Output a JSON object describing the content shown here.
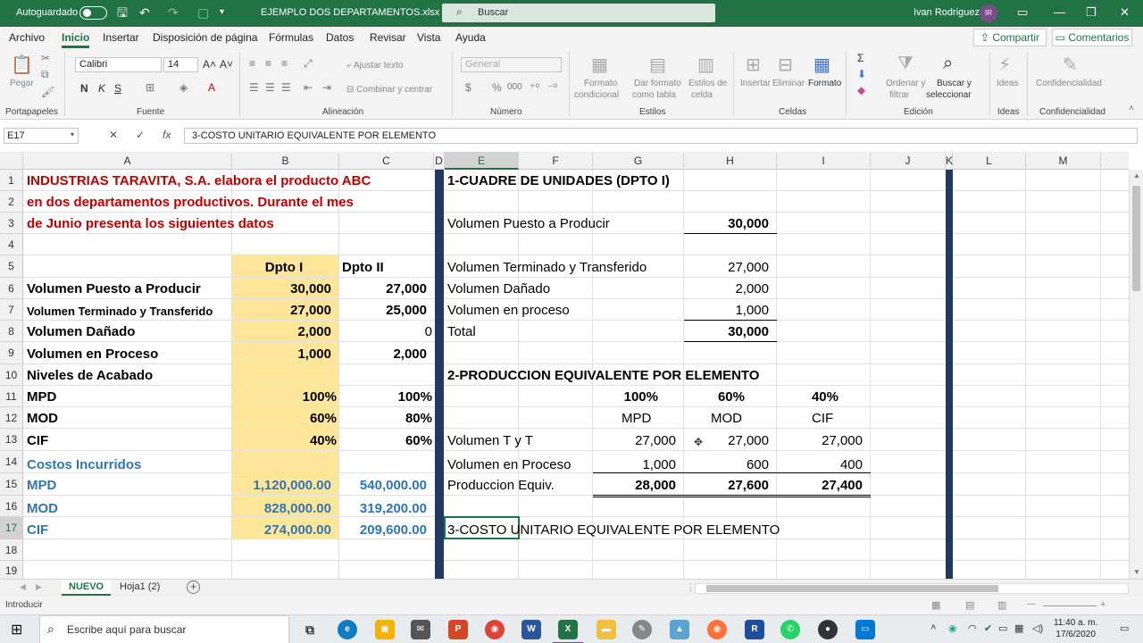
{
  "titlebar": {
    "autosave_label": "Autoguardado",
    "filename": "EJEMPLO DOS DEPARTAMENTOS.xlsx",
    "search_placeholder": "Buscar",
    "user_name": "Ivan Rodriguez",
    "user_initials": "IR"
  },
  "menu": {
    "tabs": [
      "Archivo",
      "Inicio",
      "Insertar",
      "Disposición de página",
      "Fórmulas",
      "Datos",
      "Revisar",
      "Vista",
      "Ayuda"
    ],
    "active_tab": "Inicio",
    "share_label": "Compartir",
    "comments_label": "Comentarios"
  },
  "ribbon": {
    "groups": [
      "Portapapeles",
      "Fuente",
      "Alineación",
      "Número",
      "Estilos",
      "Celdas",
      "Edición",
      "Ideas",
      "Confidencialidad"
    ],
    "paste_label": "Pegar",
    "font_name": "Calibri",
    "font_size": "14",
    "bold": "N",
    "italic": "K",
    "underline": "S",
    "wrap_text": "Ajustar texto",
    "merge_center": "Combinar y centrar",
    "number_format": "General",
    "currency": "$",
    "percent": "%",
    "thousands": "000",
    "cond_format": [
      "Formato",
      "condicional"
    ],
    "table_format": [
      "Dar formato",
      "como tabla"
    ],
    "cell_styles": [
      "Estilos de",
      "celda"
    ],
    "insert": "Insertar",
    "delete": "Eliminar",
    "format": "Formato",
    "sort_filter": [
      "Ordenar y",
      "filtrar"
    ],
    "find_select": [
      "Buscar y",
      "seleccionar"
    ],
    "ideas": "Ideas",
    "confidentiality": "Confidencialidad"
  },
  "formula_bar": {
    "name_box": "E17",
    "cancel": "✕",
    "enter": "✓",
    "fx": "fx",
    "content": "3-COSTO UNITARIO EQUIVALENTE POR ELEMENTO"
  },
  "columns": [
    "A",
    "B",
    "C",
    "D",
    "E",
    "F",
    "G",
    "H",
    "I",
    "J",
    "K",
    "L",
    "M"
  ],
  "rows": [
    "1",
    "2",
    "3",
    "4",
    "5",
    "6",
    "7",
    "8",
    "9",
    "10",
    "11",
    "12",
    "13",
    "14",
    "15",
    "16",
    "17",
    "18",
    "19"
  ],
  "cells": {
    "A1": "INDUSTRIAS TARAVITA, S.A. elabora el producto ABC",
    "A2": "en dos departamentos productivos. Durante el mes",
    "A3": "de Junio presenta los siguientes datos",
    "B5": "Dpto I",
    "C5": "Dpto II",
    "A6": "Volumen Puesto a Producir",
    "B6": "30,000",
    "C6": "27,000",
    "A7": "Volumen Terminado y Transferido",
    "B7": "27,000",
    "C7": "25,000",
    "A8": "Volumen Dañado",
    "B8": "2,000",
    "C8": "0",
    "A9": "Volumen en Proceso",
    "B9": "1,000",
    "C9": "2,000",
    "A10": "Niveles de Acabado",
    "A11": "MPD",
    "B11": "100%",
    "C11": "100%",
    "A12": "MOD",
    "B12": "60%",
    "C12": "80%",
    "A13": "CIF",
    "B13": "40%",
    "C13": "60%",
    "A14": "Costos Incurridos",
    "A15": "MPD",
    "B15": "1,120,000.00",
    "C15": "540,000.00",
    "A16": "MOD",
    "B16": "828,000.00",
    "C16": "319,200.00",
    "A17": "CIF",
    "B17": "274,000.00",
    "C17": "209,600.00",
    "E1": "1-CUADRE DE UNIDADES (DPTO I)",
    "E3": "Volumen Puesto a Producir",
    "H3": "30,000",
    "E5": "Volumen Terminado y Transferido",
    "H5": "27,000",
    "E6": "Volumen Dañado",
    "H6": "2,000",
    "E7": "Volumen en proceso",
    "H7": "1,000",
    "E8": "Total",
    "H8": "30,000",
    "E10": "2-PRODUCCION EQUIVALENTE POR ELEMENTO",
    "G11": "100%",
    "H11": "60%",
    "I11": "40%",
    "G12": "MPD",
    "H12": "MOD",
    "I12": "CIF",
    "E13": "Volumen T y T",
    "G13": "27,000",
    "H13": "27,000",
    "I13": "27,000",
    "E14": "Volumen en Proceso",
    "G14": "1,000",
    "H14": "600",
    "I14": "400",
    "E15": "Produccion Equiv.",
    "G15": "28,000",
    "H15": "27,600",
    "I15": "27,400",
    "E17": "3-COSTO UNITARIO EQUIVALENTE POR ELEMENTO"
  },
  "sheets": [
    "NUEVO",
    "Hoja1 (2)"
  ],
  "active_sheet": "NUEVO",
  "status": {
    "mode": "Introducir"
  },
  "taskbar": {
    "search_placeholder": "Escribe aquí para buscar",
    "time": "11:40 a. m.",
    "date": "17/6/2020"
  },
  "colors": {
    "excel_green": "#217346",
    "highlight_fill": "#ffe699",
    "title_red": "#c00000",
    "cost_blue": "#2e75b6",
    "separator_navy": "#1f3864"
  }
}
